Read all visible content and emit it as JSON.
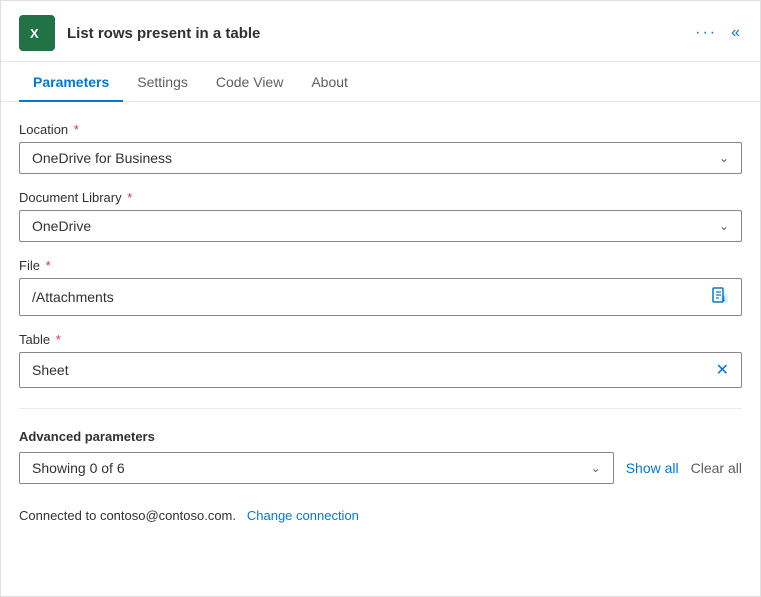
{
  "header": {
    "title": "List rows present in a table",
    "more_icon": "···",
    "collapse_icon": "«"
  },
  "tabs": [
    {
      "label": "Parameters",
      "active": true
    },
    {
      "label": "Settings",
      "active": false
    },
    {
      "label": "Code View",
      "active": false
    },
    {
      "label": "About",
      "active": false
    }
  ],
  "fields": {
    "location": {
      "label": "Location",
      "required": true,
      "value": "OneDrive for Business"
    },
    "document_library": {
      "label": "Document Library",
      "required": true,
      "value": "OneDrive"
    },
    "file": {
      "label": "File",
      "required": true,
      "value": "/Attachments"
    },
    "table": {
      "label": "Table",
      "required": true,
      "value": "Sheet"
    }
  },
  "advanced": {
    "label": "Advanced parameters",
    "dropdown_value": "Showing 0 of 6",
    "show_all_label": "Show all",
    "clear_all_label": "Clear all"
  },
  "footer": {
    "text": "Connected to contoso@contoso.com.",
    "link": "Change connection"
  },
  "icons": {
    "chevron": "⌄",
    "file_icon": "🗎",
    "close": "✕"
  }
}
